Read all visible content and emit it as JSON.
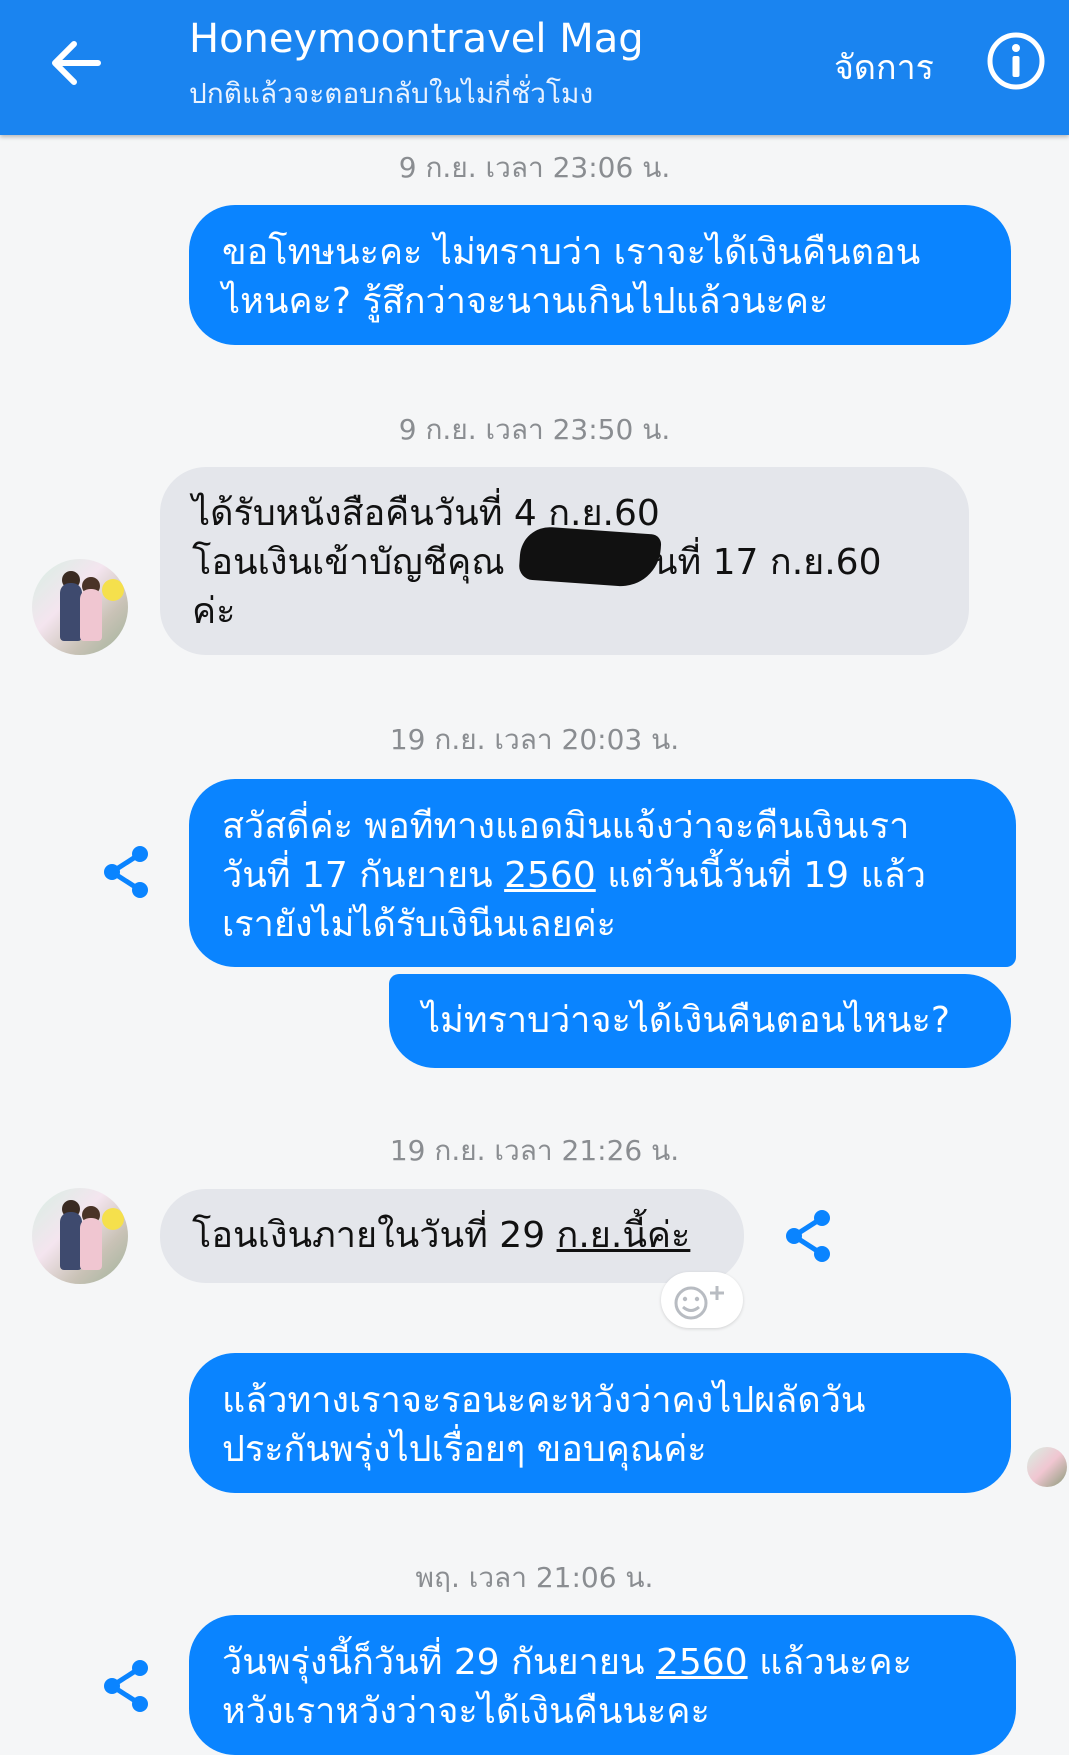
{
  "header": {
    "title": "Honeymoontravel Mag",
    "subtitle": "ปกติแล้วจะตอบกลับในไม่กี่ชั่วโมง",
    "manage_label": "จัดการ"
  },
  "colors": {
    "header_bg": "#1a84f0",
    "outgoing_bubble": "#0a84ff",
    "incoming_bubble": "#e4e6eb",
    "background": "#f5f6f7"
  },
  "messages": {
    "t1": "9 ก.ย. เวลา 23:06 น.",
    "m1_line1": "ขอโทษนะคะ ไม่ทราบว่า เราจะได้เงินคืนตอน",
    "m1_line2": "ไหนคะ? รู้สึกว่าจะนานเกินไปแล้วนะคะ",
    "t2": "9 ก.ย. เวลา 23:50 น.",
    "m2_line1": "ได้รับหนังสือคืนวันที่ 4 ก.ย.60",
    "m2_line2a": "โอนเงินเข้าบัญชีคุณ",
    "m2_line2b": "วันที่ 17 ก.ย.60",
    "m2_line3": "ค่ะ",
    "t3": "19 ก.ย. เวลา 20:03 น.",
    "m3_line1": "สวัสดี่ค่ะ พอทีทางแอดมินแจ้งว่าจะคืนเงินเรา",
    "m3_line2a": "วันที่ 17 กันยายน ",
    "m3_line2b": "2560",
    "m3_line2c": " แต่วันนี้วันที่ 19 แล้ว",
    "m3_line3": "เรายังไม่ได้รับเงินีนเลยค่ะ",
    "m4": "ไม่ทราบว่าจะได้เงินคืนตอนไหนะ?",
    "t4": "19 ก.ย. เวลา 21:26 น.",
    "m5a": "โอนเงินภายในวันที่ 29 ",
    "m5b": "ก.ย.นี้ค่ะ",
    "m6_line1": "แล้วทางเราจะรอนะคะหวังว่าคงไปผลัดวัน",
    "m6_line2": "ประกันพรุ่งไปเรื่อยๆ  ขอบคุณค่ะ",
    "t5": "พฤ. เวลา 21:06 น.",
    "m7_line1a": "วันพรุ่งนี้ก็วันที่ 29 กันยายน ",
    "m7_line1b": "2560",
    "m7_line1c": " แล้วนะคะ",
    "m7_line2": "หวังเราหวังว่าจะได้เงินคืนนะคะ"
  }
}
